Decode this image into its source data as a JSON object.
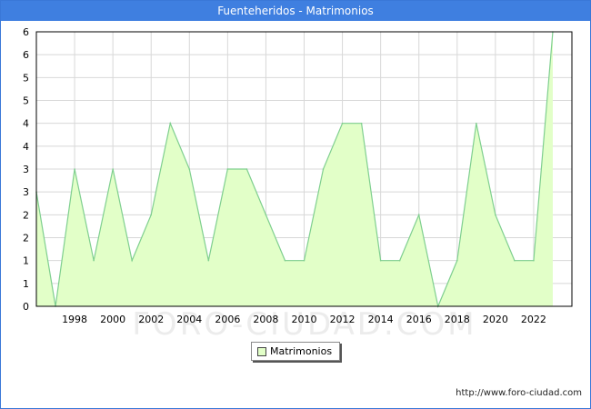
{
  "header": {
    "title": "Fuenteheridos - Matrimonios"
  },
  "legend": {
    "label": "Matrimonios"
  },
  "footer": {
    "url": "http://www.foro-ciudad.com"
  },
  "watermark": "FORO-CIUDAD.COM",
  "colors": {
    "title_bg": "#3f7fe0",
    "area_fill": "#e2ffc8",
    "line": "#7fcf8f",
    "grid": "#d8d8d8"
  },
  "chart_data": {
    "type": "area",
    "title": "Fuenteheridos - Matrimonios",
    "x": [
      1996,
      1997,
      1998,
      1999,
      2000,
      2001,
      2002,
      2003,
      2004,
      2005,
      2006,
      2007,
      2008,
      2009,
      2010,
      2011,
      2012,
      2013,
      2014,
      2015,
      2016,
      2017,
      2018,
      2019,
      2020,
      2021,
      2022,
      2023
    ],
    "series": [
      {
        "name": "Matrimonios",
        "values": [
          5,
          0,
          6,
          2,
          6,
          2,
          4,
          8,
          6,
          2,
          6,
          6,
          4,
          2,
          2,
          6,
          8,
          8,
          2,
          2,
          4,
          0,
          2,
          8,
          4,
          2,
          2,
          12
        ]
      }
    ],
    "xticks": [
      "1998",
      "2000",
      "2002",
      "2004",
      "2006",
      "2008",
      "2010",
      "2012",
      "2014",
      "2016",
      "2018",
      "2020",
      "2022"
    ],
    "yticks": [
      "0",
      "1",
      "1",
      "2",
      "2",
      "3",
      "3",
      "4",
      "4",
      "5",
      "5",
      "6",
      "6"
    ],
    "xlim": [
      1996,
      2024
    ],
    "ylim": [
      0,
      12
    ],
    "grid": true,
    "legend_position": "bottom-center"
  }
}
